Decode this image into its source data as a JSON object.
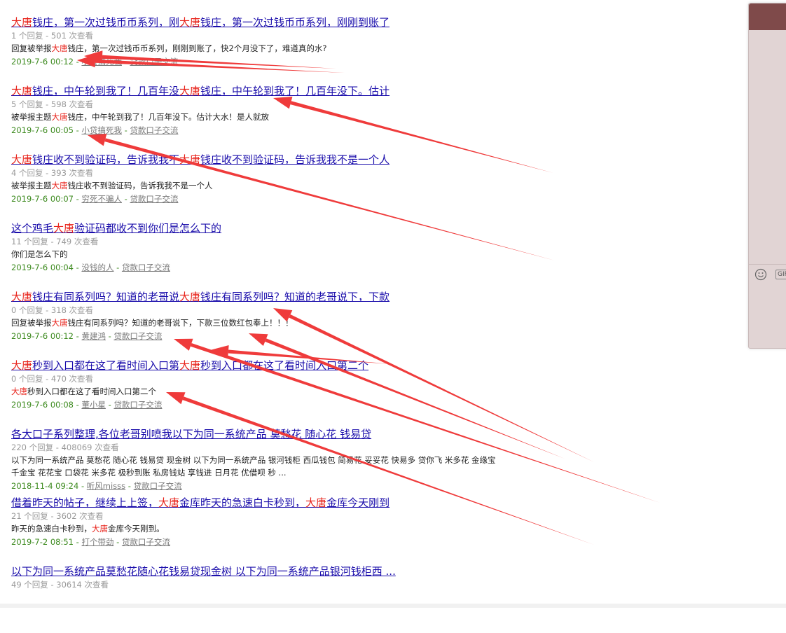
{
  "results": [
    {
      "title": [
        {
          "t": "大唐",
          "h": true
        },
        {
          "t": "钱庄，第一次过钱币币系列，刚",
          "h": false
        },
        {
          "t": "大唐",
          "h": true
        },
        {
          "t": "钱庄，第一次过钱币币系列，刚刚到账了",
          "h": false
        }
      ],
      "stats": "1 个回复 - 501 次查看",
      "snippet": [
        {
          "t": "回复被举报",
          "h": false
        },
        {
          "t": "大唐",
          "h": true
        },
        {
          "t": "钱庄，第一次过钱币币系列，刚刚到账了，快2个月没下了，难道真的水?",
          "h": false
        }
      ],
      "date": "2019-7-6 00:12",
      "author": "小贷搞死我",
      "forum": "贷款口子交流"
    },
    {
      "title": [
        {
          "t": "大唐",
          "h": true
        },
        {
          "t": "钱庄，中午轮到我了！几百年没",
          "h": false
        },
        {
          "t": "大唐",
          "h": true
        },
        {
          "t": "钱庄，中午轮到我了！几百年没下。估计",
          "h": false
        }
      ],
      "stats": "5 个回复 - 598 次查看",
      "snippet": [
        {
          "t": "被举报主题",
          "h": false
        },
        {
          "t": "大唐",
          "h": true
        },
        {
          "t": "钱庄，中午轮到我了！几百年没下。估计大水！是人就放",
          "h": false
        }
      ],
      "date": "2019-7-6 00:05",
      "author": "小贷搞死我",
      "forum": "贷款口子交流"
    },
    {
      "title": [
        {
          "t": "大唐",
          "h": true
        },
        {
          "t": "钱庄收不到验证码，告诉我我不",
          "h": false
        },
        {
          "t": "大唐",
          "h": true
        },
        {
          "t": "钱庄收不到验证码，告诉我我不是一个人",
          "h": false
        }
      ],
      "stats": "4 个回复 - 393 次查看",
      "snippet": [
        {
          "t": "被举报主题",
          "h": false
        },
        {
          "t": "大唐",
          "h": true
        },
        {
          "t": "钱庄收不到验证码，告诉我我不是一个人",
          "h": false
        }
      ],
      "date": "2019-7-6 00:07",
      "author": "穷死不骗人",
      "forum": "贷款口子交流"
    },
    {
      "title": [
        {
          "t": "这个鸡毛",
          "h": false
        },
        {
          "t": "大唐",
          "h": true
        },
        {
          "t": "验证码都收不到你们是怎么下的",
          "h": false
        }
      ],
      "stats": "11 个回复 - 749 次查看",
      "snippet": [
        {
          "t": "你们是怎么下的",
          "h": false
        }
      ],
      "date": "2019-7-6 00:04",
      "author": "没钱的人",
      "forum": "贷款口子交流"
    },
    {
      "title": [
        {
          "t": "大唐",
          "h": true
        },
        {
          "t": "钱庄有同系列吗？知道的老哥说",
          "h": false
        },
        {
          "t": "大唐",
          "h": true
        },
        {
          "t": "钱庄有同系列吗？知道的老哥说下，下款",
          "h": false
        }
      ],
      "stats": "0 个回复 - 318 次查看",
      "snippet": [
        {
          "t": "回复被举报",
          "h": false
        },
        {
          "t": "大唐",
          "h": true
        },
        {
          "t": "钱庄有同系列吗？知道的老哥说下，下款三位数红包奉上！！！",
          "h": false
        }
      ],
      "date": "2019-7-6 00:12",
      "author": "黄建鸿",
      "forum": "贷款口子交流"
    },
    {
      "title": [
        {
          "t": "大唐",
          "h": true
        },
        {
          "t": "秒到入口都在这了看时间入口第",
          "h": false
        },
        {
          "t": "大唐",
          "h": true
        },
        {
          "t": "秒到入口都在这了看时间入口第二个",
          "h": false
        }
      ],
      "stats": "0 个回复 - 470 次查看",
      "snippet": [
        {
          "t": "大唐",
          "h": true
        },
        {
          "t": "秒到入口都在这了看时间入口第二个",
          "h": false
        }
      ],
      "date": "2019-7-6 00:08",
      "author": "董小星",
      "forum": "贷款口子交流"
    },
    {
      "title": [
        {
          "t": "各大口子系列整理,各位老哥别喷我以下为同一系统产品 莫愁花 随心花 钱易贷",
          "h": false
        }
      ],
      "stats": "220 个回复 - 408069 次查看",
      "snippet": [
        {
          "t": "以下为同一系统产品 莫愁花 随心花 钱易贷 现金树       以下为同一系统产品 银河钱柜 西瓜钱包 简易花 妥妥花 快易多 贷你飞 米多花 金缘宝",
          "h": false
        }
      ],
      "snippet2": [
        {
          "t": "千金宝 花花宝 口袋花 米多花 极秒到账 私房钱站 享钱进 日月花 优借呗 秒 ...",
          "h": false
        }
      ],
      "date": "2018-11-4 09:24",
      "author": "听风misss",
      "forum": "贷款口子交流"
    },
    {
      "title": [
        {
          "t": "借着昨天的帖子，继续上上签，",
          "h": false
        },
        {
          "t": "大唐",
          "h": true
        },
        {
          "t": "金库昨天的急速白卡秒到，",
          "h": false
        },
        {
          "t": "大唐",
          "h": true
        },
        {
          "t": "金库今天刚到",
          "h": false
        }
      ],
      "stats": "21 个回复 - 3602 次查看",
      "snippet": [
        {
          "t": "昨天的急速白卡秒到，",
          "h": false
        },
        {
          "t": "大唐",
          "h": true
        },
        {
          "t": "金库今天刚到。",
          "h": false
        }
      ],
      "date": "2019-7-2 08:51",
      "author": "打个带劲",
      "forum": "贷款口子交流"
    },
    {
      "title": [
        {
          "t": "以下为同一系统产品莫愁花随心花钱易贷现金树       以下为同一系统产品银河钱柜西 ...",
          "h": false
        }
      ],
      "stats": "49 个回复 - 30614 次查看",
      "snippet": [],
      "date": "",
      "author": "",
      "forum": ""
    }
  ],
  "side_panel": {
    "header_color": "#7f4a4a",
    "body_color": "#e1d4d4",
    "emoji_icon": "smiley-icon",
    "gif_label": "GIF"
  },
  "annotation": {
    "arrow_color": "#ef3b3b",
    "arrow_count": 9
  },
  "colors": {
    "link": "#1a0dab",
    "highlight": "#e8231b",
    "date": "#3c8a1e",
    "stats": "#999999"
  }
}
